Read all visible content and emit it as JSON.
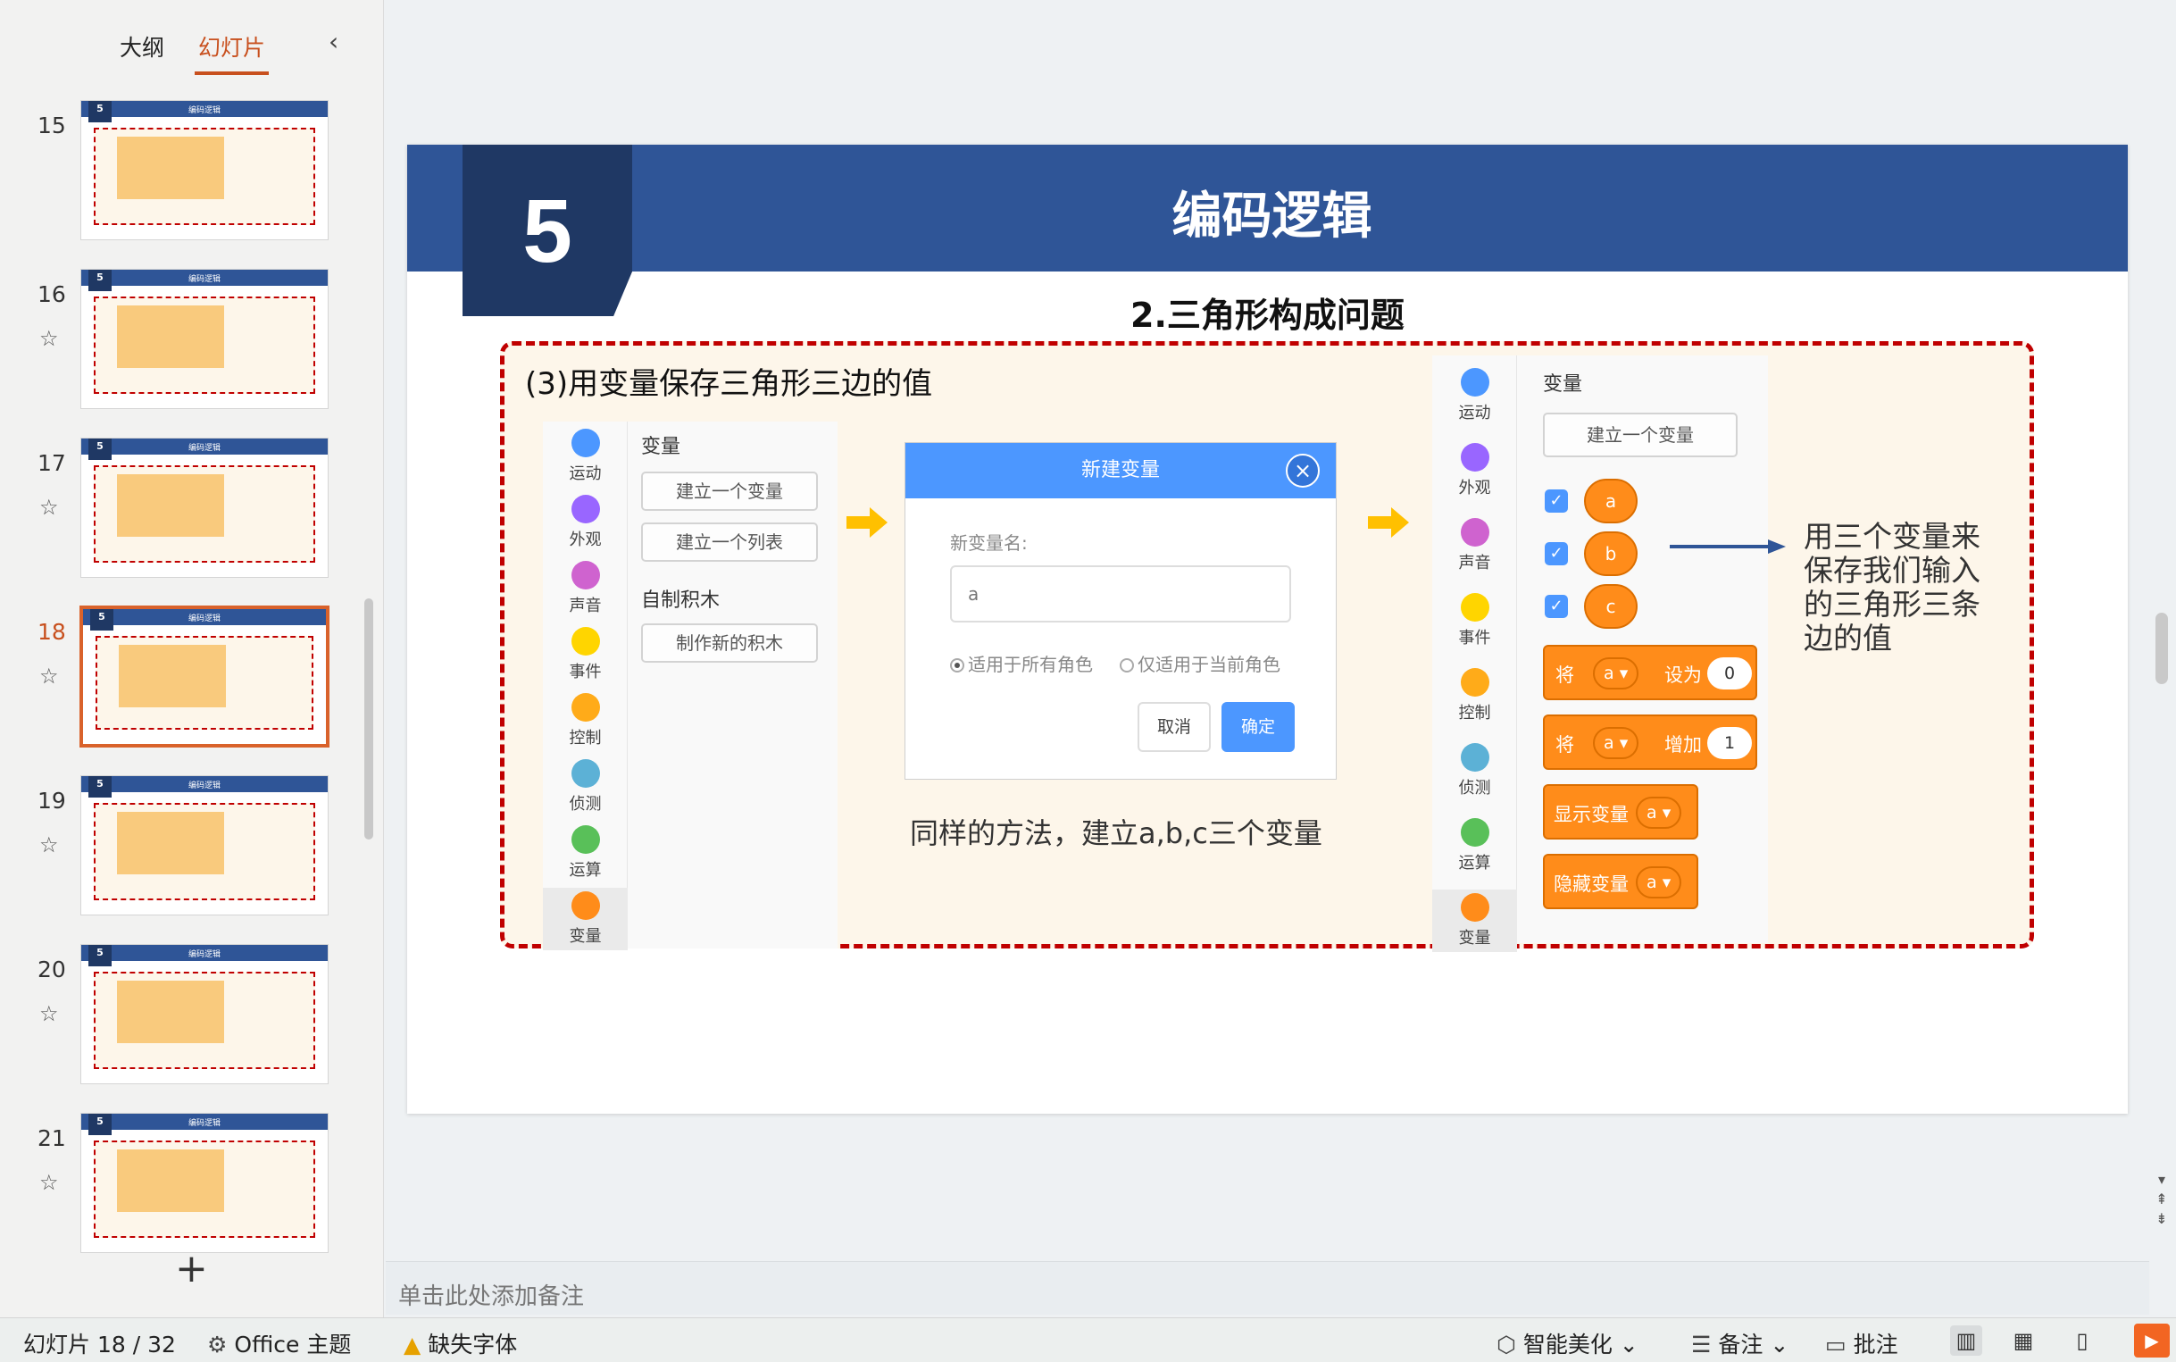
{
  "left_panel": {
    "tabs": [
      {
        "label": "大纲",
        "active": false
      },
      {
        "label": "幻灯片",
        "active": true
      }
    ],
    "thumbnails": [
      {
        "number": "15",
        "badge": "5",
        "title": "编码逻辑",
        "active": false
      },
      {
        "number": "16",
        "badge": "5",
        "title": "编码逻辑",
        "active": false
      },
      {
        "number": "17",
        "badge": "5",
        "title": "编码逻辑",
        "active": false
      },
      {
        "number": "18",
        "badge": "5",
        "title": "编码逻辑",
        "active": true
      },
      {
        "number": "19",
        "badge": "5",
        "title": "编码逻辑",
        "active": false
      },
      {
        "number": "20",
        "badge": "5",
        "title": "编码逻辑",
        "active": false
      },
      {
        "number": "21",
        "badge": "5",
        "title": "编码逻辑",
        "active": false
      }
    ],
    "add_label": "+"
  },
  "slide": {
    "number": "5",
    "title": "编码逻辑",
    "subtitle": "2.三角形构成问题",
    "heading": "(3)用变量保存三角形三边的值",
    "left_palette": {
      "categories": [
        "运动",
        "外观",
        "声音",
        "事件",
        "控制",
        "侦测",
        "运算",
        "变量"
      ],
      "colors": [
        "#4c97ff",
        "#9966ff",
        "#cf63cf",
        "#ffd500",
        "#ffab19",
        "#5cb1d6",
        "#59c059",
        "#ff8c1a"
      ],
      "section_variables": "变量",
      "btn_make_variable": "建立一个变量",
      "btn_make_list": "建立一个列表",
      "section_custom": "自制积木",
      "btn_make_block": "制作新的积木"
    },
    "dialog": {
      "title": "新建变量",
      "close": "×",
      "label": "新变量名:",
      "input_value": "a",
      "radio_all": "适用于所有角色",
      "radio_current": "仅适用于当前角色",
      "cancel": "取消",
      "ok": "确定"
    },
    "mid_caption": "同样的方法，建立a,b,c三个变量",
    "right_palette": {
      "categories": [
        "运动",
        "外观",
        "声音",
        "事件",
        "控制",
        "侦测",
        "运算",
        "变量"
      ],
      "section_variables": "变量",
      "btn_make_variable": "建立一个变量",
      "variables": [
        "a",
        "b",
        "c"
      ],
      "block_set": {
        "verb": "将",
        "var": "a",
        "action": "设为",
        "value": "0"
      },
      "block_change": {
        "verb": "将",
        "var": "a",
        "action": "增加",
        "value": "1"
      },
      "block_show": {
        "label": "显示变量",
        "var": "a"
      },
      "block_hide": {
        "label": "隐藏变量",
        "var": "a"
      }
    },
    "right_note": "用三个变量来保存我们输入的三角形三条边的值"
  },
  "notes_placeholder": "单击此处添加备注",
  "status_bar": {
    "slide_info": "幻灯片 18 / 32",
    "theme": "Office 主题",
    "missing_font": "缺失字体",
    "smart_beautify": "智能美化",
    "notes": "备注",
    "comments": "批注"
  },
  "colors": {
    "accent": "#c8501e",
    "band": "#2f5597",
    "band_dark": "#1f3864",
    "dashed_red": "#c00000",
    "scratch_orange": "#ff8c1a",
    "scratch_blue": "#4c97ff"
  }
}
